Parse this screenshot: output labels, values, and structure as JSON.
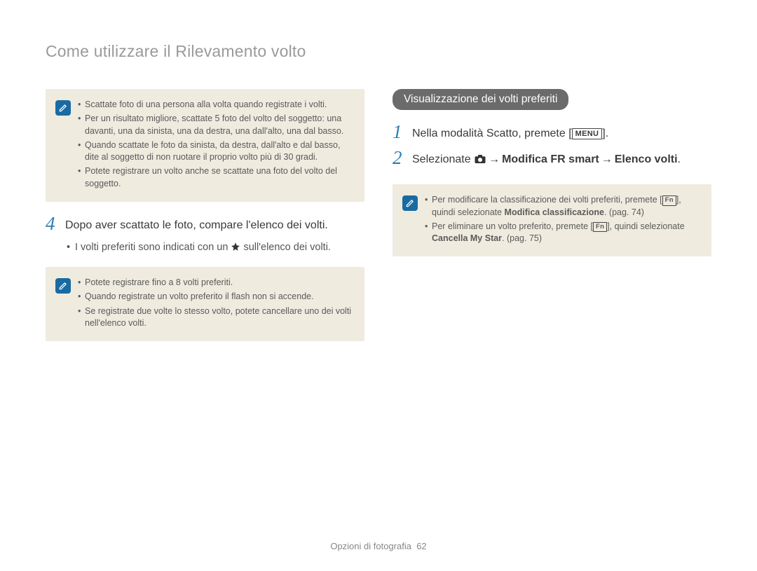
{
  "page_title": "Come utilizzare il Rilevamento volto",
  "left": {
    "note1": {
      "items": [
        "Scattate foto di una persona alla volta quando registrate i volti.",
        "Per un risultato migliore, scattate 5 foto del volto del soggetto: una davanti, una da sinista, una da destra, una dall'alto, una dal basso.",
        "Quando scattate le foto da sinista, da destra, dall'alto e dal basso, dite al soggetto di non ruotare il proprio volto più di 30 gradi.",
        "Potete registrare un volto anche se scattate una foto del volto del soggetto."
      ]
    },
    "step4_num": "4",
    "step4_text": "Dopo aver scattato le foto, compare l'elenco dei volti.",
    "step4_sub_before": "I volti preferiti sono indicati con un ",
    "step4_sub_after": " sull'elenco dei volti.",
    "note2": {
      "items": [
        "Potete registrare fino a 8 volti preferiti.",
        "Quando registrate un volto preferito il flash non si accende.",
        "Se registrate due volte lo stesso volto, potete cancellare uno dei volti nell'elenco volti."
      ]
    }
  },
  "right": {
    "section_header": "Visualizzazione dei volti preferiti",
    "step1_num": "1",
    "step1_before": "Nella modalità Scatto, premete [",
    "step1_key": "MENU",
    "step1_after": "].",
    "step2_num": "2",
    "step2_before": "Selezionate ",
    "step2_arrow1": "→",
    "step2_b1": "Modifica FR smart",
    "step2_arrow2": "→",
    "step2_b2": "Elenco volti",
    "step2_end": ".",
    "note3": {
      "item1_before": "Per modificare la classificazione dei volti preferiti, premete [",
      "item1_key": "Fn",
      "item1_mid": "], quindi selezionate ",
      "item1_bold": "Modifica classificazione",
      "item1_after": ". (pag. 74)",
      "item2_before": "Per eliminare un volto preferito, premete [",
      "item2_key": "Fn",
      "item2_mid": "], quindi selezionate ",
      "item2_bold": "Cancella My Star",
      "item2_after": ". (pag. 75)"
    }
  },
  "footer_label": "Opzioni di fotografia",
  "footer_page": "62"
}
